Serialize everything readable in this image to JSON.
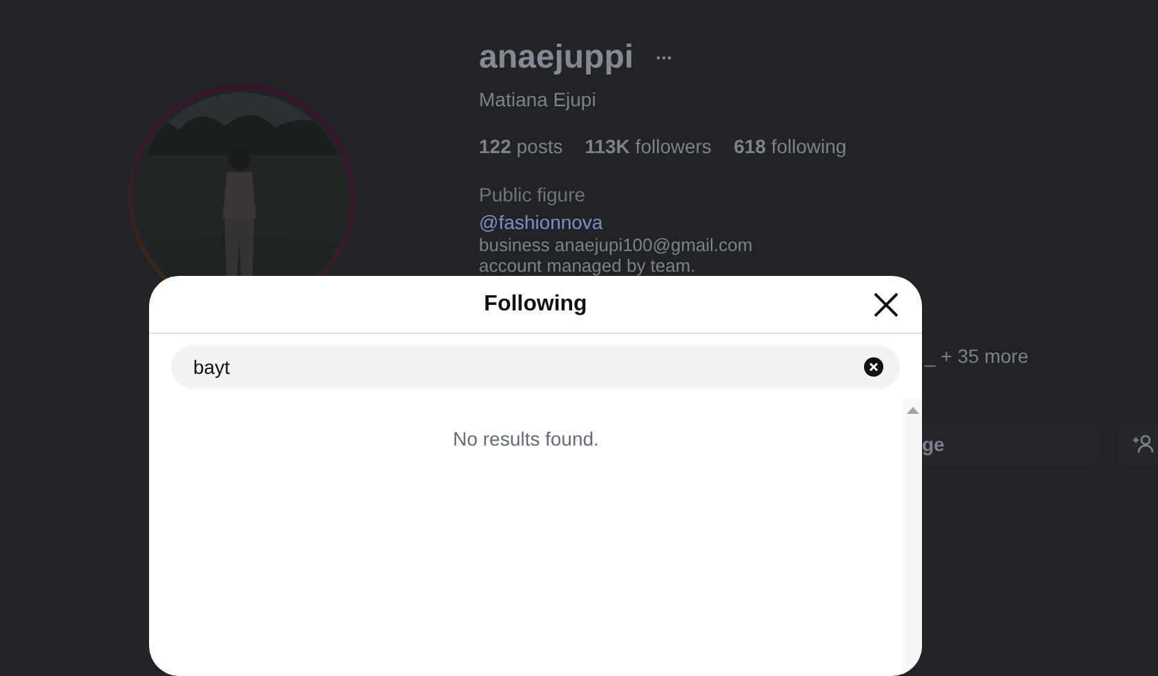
{
  "profile": {
    "username": "anaejuppi",
    "full_name": "Matiana Ejupi",
    "stats": [
      "**122** posts",
      "**113K** followers",
      "**618** following"
    ],
    "category": "Public figure",
    "link": "@fashionnova",
    "bio": [
      "business anaejupi100@gmail.com",
      "account managed by team."
    ],
    "followed_by": "_ + 35 more",
    "message_button": "ge"
  },
  "dialog": {
    "title": "Following",
    "search": {
      "value": "bayt"
    },
    "empty_message": "No results found."
  }
}
